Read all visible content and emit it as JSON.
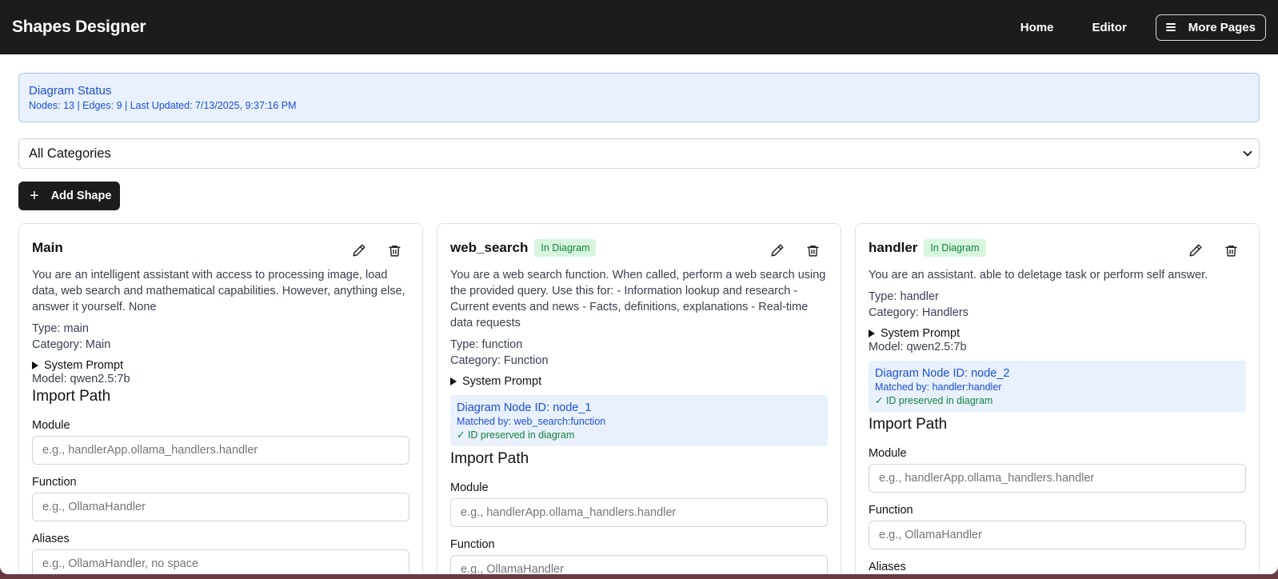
{
  "header": {
    "brand": "Shapes Designer",
    "nav": {
      "home": "Home",
      "editor": "Editor",
      "more": "More Pages"
    }
  },
  "status": {
    "title": "Diagram Status",
    "text": "Nodes: 13 | Edges: 9 | Last Updated: 7/13/2025, 9:37:16 PM"
  },
  "filter": {
    "selected": "All Categories"
  },
  "toolbar": {
    "add_label": "Add Shape"
  },
  "cards": [
    {
      "title": "Main",
      "badge": "",
      "description": "You are an intelligent assistant with access to processing image, load data, web search and mathematical capabilities. However, anything else, answer it yourself. None",
      "type": "Type: main",
      "category": "Category: Main",
      "system_prompt": "System Prompt",
      "model": "Model: qwen2.5:7b",
      "import_title": "Import Path",
      "module_label": "Module",
      "module_placeholder": "e.g., handlerApp.ollama_handlers.handler",
      "function_label": "Function",
      "function_placeholder": "e.g., OllamaHandler",
      "aliases_label": "Aliases",
      "aliases_placeholder": "e.g., OllamaHandler, no space"
    },
    {
      "title": "web_search",
      "badge": "In Diagram",
      "description": "You are a web search function. When called, perform a web search using the provided query. Use this for: - Information lookup and research - Current events and news - Facts, definitions, explanations - Real-time data requests",
      "type": "Type: function",
      "category": "Category: Function",
      "system_prompt": "System Prompt",
      "node_id": "Diagram Node ID: node_1",
      "matched_by": "Matched by: web_search:function",
      "preserved": "✓ ID preserved in diagram",
      "import_title": "Import Path",
      "module_label": "Module",
      "module_placeholder": "e.g., handlerApp.ollama_handlers.handler",
      "function_label": "Function",
      "function_placeholder": "e.g., OllamaHandler"
    },
    {
      "title": "handler",
      "badge": "In Diagram",
      "description": "You are an assistant. able to deletage task or perform self answer.",
      "type": "Type: handler",
      "category": "Category: Handlers",
      "system_prompt": "System Prompt",
      "model": "Model: qwen2.5:7b",
      "node_id": "Diagram Node ID: node_2",
      "matched_by": "Matched by: handler:handler",
      "preserved": "✓ ID preserved in diagram",
      "import_title": "Import Path",
      "module_label": "Module",
      "module_placeholder": "e.g., handlerApp.ollama_handlers.handler",
      "function_label": "Function",
      "function_placeholder": "e.g., OllamaHandler",
      "aliases_label": "Aliases"
    }
  ],
  "icons": {
    "edit": "pencil-icon",
    "delete": "trash-icon",
    "menu": "menu-icon",
    "add": "plus-icon",
    "expand": "triangle-right-icon",
    "select": "chevron-down-icon"
  }
}
